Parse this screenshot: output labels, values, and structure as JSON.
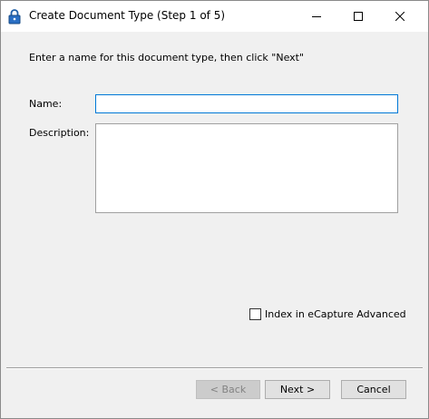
{
  "window": {
    "title": "Create Document Type (Step 1 of 5)",
    "icon": "padlock-icon"
  },
  "caption_buttons": {
    "minimize": "minimize-icon",
    "maximize": "maximize-icon",
    "close": "close-icon"
  },
  "form": {
    "instruction": "Enter a name for this document type, then click \"Next\"",
    "name_label": "Name:",
    "name_value": "",
    "description_label": "Description:",
    "description_value": "",
    "checkbox_label": "Index in eCapture Advanced",
    "checkbox_checked": false
  },
  "buttons": {
    "back": "< Back",
    "next": "Next >",
    "cancel": "Cancel"
  },
  "colors": {
    "focus_border": "#0078d7",
    "dialog_background": "#f0f0f0",
    "disabled_text": "#838383"
  }
}
